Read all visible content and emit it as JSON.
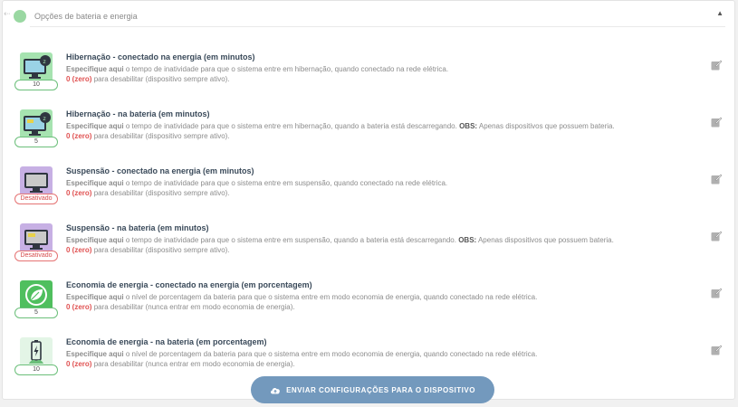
{
  "panel": {
    "title": "Opções de bateria e energia",
    "collapse_icon": "▲",
    "back_icon": "⇠"
  },
  "common": {
    "specify_bold": "Especifique aqui",
    "zero_label": "0 (zero)",
    "obs_label": "OBS:"
  },
  "settings": [
    {
      "title": "Hibernação - conectado na energia (em minutos)",
      "desc1": "o tempo de inatividade para que o sistema entre em hibernação, quando conectado na rede elétrica.",
      "obs": "",
      "desc2": "para desabilitar (dispositivo sempre ativo).",
      "value": "10",
      "icon": "monitor-sleep-icon"
    },
    {
      "title": "Hibernação - na bateria (em minutos)",
      "desc1": "o tempo de inatividade para que o sistema entre em hibernação, quando a bateria está descarregando.",
      "obs": "Apenas dispositivos que possuem bateria.",
      "desc2": "para desabilitar (dispositivo sempre ativo).",
      "value": "5",
      "icon": "monitor-battery-sleep-icon"
    },
    {
      "title": "Suspensão - conectado na energia (em minutos)",
      "desc1": "o tempo de inatividade para que o sistema entre em suspensão, quando conectado na rede elétrica.",
      "obs": "",
      "desc2": "para desabilitar (dispositivo sempre ativo).",
      "value": "Desativado",
      "icon": "monitor-icon"
    },
    {
      "title": "Suspensão - na bateria (em minutos)",
      "desc1": "o tempo de inatividade para que o sistema entre em suspensão, quando a bateria está descarregando.",
      "obs": "Apenas dispositivos que possuem bateria.",
      "desc2": "para desabilitar (dispositivo sempre ativo).",
      "value": "Desativado",
      "icon": "monitor-battery-icon"
    },
    {
      "title": "Economia de energia - conectado na energia (em porcentagem)",
      "desc1": "o nível de porcentagem da bateria para que o sistema entre em modo economia de energia, quando conectado na rede elétrica.",
      "obs": "",
      "desc2": "para desabilitar (nunca entrar em modo economia de energia).",
      "value": "5",
      "icon": "leaf-icon"
    },
    {
      "title": "Economia de energia - na bateria (em porcentagem)",
      "desc1": "o nível de porcentagem da bateria para que o sistema entre em modo economia de energia, quando conectado na rede elétrica.",
      "obs": "",
      "desc2": "para desabilitar (nunca entrar em modo economia de energia).",
      "value": "10",
      "icon": "battery-charging-icon"
    }
  ],
  "footer": {
    "send_label": "ENVIAR CONFIGURAÇÕES PARA O DISPOSITIVO",
    "send_icon": "cloud-upload-icon"
  },
  "colors": {
    "active_tile": "#a6e3b0",
    "disabled_tile": "#c7b0e4",
    "zero_red": "#e05252",
    "button_blue": "#7399bd"
  }
}
